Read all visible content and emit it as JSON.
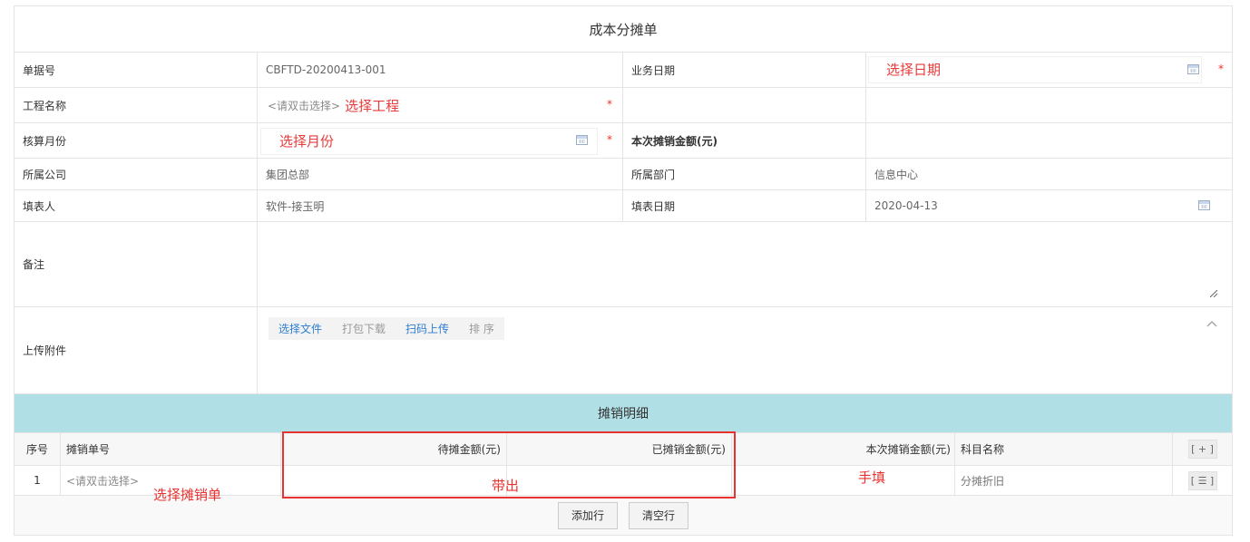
{
  "form": {
    "title": "成本分摊单",
    "doc_no_label": "单据号",
    "doc_no_value": "CBFTD-20200413-001",
    "biz_date_label": "业务日期",
    "biz_date_annotation": "选择日期",
    "project_label": "工程名称",
    "project_placeholder": "<请双击选择>",
    "project_annotation": "选择工程",
    "month_label": "核算月份",
    "month_annotation": "选择月份",
    "amount_label": "本次摊销金额(元)",
    "company_label": "所属公司",
    "company_value": "集团总部",
    "dept_label": "所属部门",
    "dept_value": "信息中心",
    "filler_label": "填表人",
    "filler_value": "软件-接玉明",
    "fill_date_label": "填表日期",
    "fill_date_value": "2020-04-13",
    "remark_label": "备注",
    "attach_label": "上传附件",
    "required_mark": "*",
    "attach_buttons": [
      "选择文件",
      "打包下载",
      "扫码上传",
      "排 序"
    ],
    "collapse_icon": "chevron-up-icon"
  },
  "detail": {
    "title": "摊销明细",
    "columns": [
      "序号",
      "摊销单号",
      "待摊金额(元)",
      "已摊销金额(元)",
      "本次摊销金额(元)",
      "科目名称"
    ],
    "add_row_symbol": "[ + ]",
    "row_menu_symbol": "[ ☰ ]",
    "rows": [
      {
        "seq": "1",
        "no": "<请双击选择>",
        "dai": "",
        "yi": "",
        "current": "",
        "subject": "分摊折旧"
      }
    ],
    "add_button": "添加行",
    "clear_button": "清空行"
  },
  "annotations": {
    "select_amort": "选择摊销单",
    "carry_out": "带出",
    "manual_fill": "手填"
  },
  "colors": {
    "accent_header": "#b0dfe5",
    "annotation_red": "#e8322f",
    "link_blue": "#2d7dd2"
  }
}
